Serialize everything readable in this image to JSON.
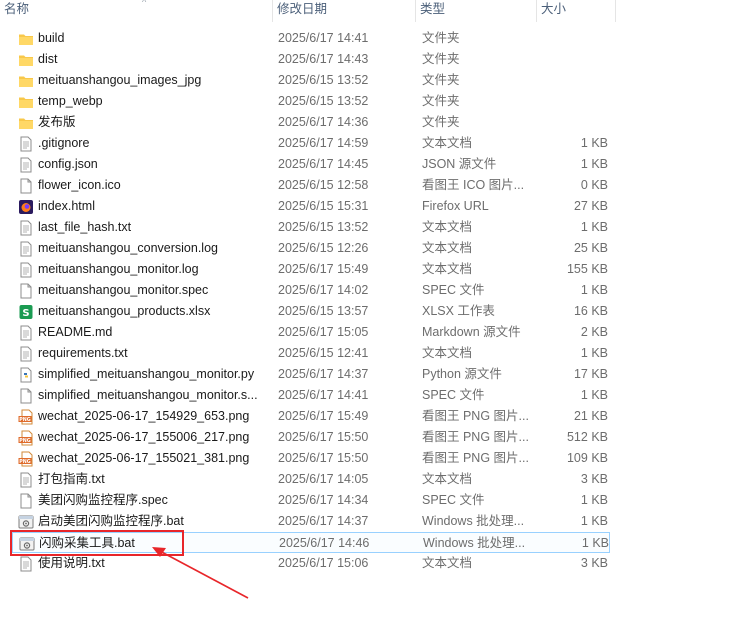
{
  "columns": {
    "name": "名称",
    "date": "修改日期",
    "type": "类型",
    "size": "大小"
  },
  "files": [
    {
      "name": "build",
      "date": "2025/6/17 14:41",
      "type": "文件夹",
      "size": "",
      "icon": "folder-icon"
    },
    {
      "name": "dist",
      "date": "2025/6/17 14:43",
      "type": "文件夹",
      "size": "",
      "icon": "folder-icon"
    },
    {
      "name": "meituanshangou_images_jpg",
      "date": "2025/6/15 13:52",
      "type": "文件夹",
      "size": "",
      "icon": "folder-icon"
    },
    {
      "name": "temp_webp",
      "date": "2025/6/15 13:52",
      "type": "文件夹",
      "size": "",
      "icon": "folder-icon"
    },
    {
      "name": "发布版",
      "date": "2025/6/17 14:36",
      "type": "文件夹",
      "size": "",
      "icon": "folder-icon"
    },
    {
      "name": ".gitignore",
      "date": "2025/6/17 14:59",
      "type": "文本文档",
      "size": "1 KB",
      "icon": "text-file-icon"
    },
    {
      "name": "config.json",
      "date": "2025/6/17 14:45",
      "type": "JSON 源文件",
      "size": "1 KB",
      "icon": "text-file-icon"
    },
    {
      "name": "flower_icon.ico",
      "date": "2025/6/15 12:58",
      "type": "看图王 ICO 图片...",
      "size": "0 KB",
      "icon": "blank-file-icon"
    },
    {
      "name": "index.html",
      "date": "2025/6/15 15:31",
      "type": "Firefox URL",
      "size": "27 KB",
      "icon": "firefox-icon"
    },
    {
      "name": "last_file_hash.txt",
      "date": "2025/6/15 13:52",
      "type": "文本文档",
      "size": "1 KB",
      "icon": "text-file-icon"
    },
    {
      "name": "meituanshangou_conversion.log",
      "date": "2025/6/15 12:26",
      "type": "文本文档",
      "size": "25 KB",
      "icon": "text-file-icon"
    },
    {
      "name": "meituanshangou_monitor.log",
      "date": "2025/6/17 15:49",
      "type": "文本文档",
      "size": "155 KB",
      "icon": "text-file-icon"
    },
    {
      "name": "meituanshangou_monitor.spec",
      "date": "2025/6/17 14:02",
      "type": "SPEC 文件",
      "size": "1 KB",
      "icon": "blank-file-icon"
    },
    {
      "name": "meituanshangou_products.xlsx",
      "date": "2025/6/15 13:57",
      "type": "XLSX 工作表",
      "size": "16 KB",
      "icon": "spreadsheet-icon"
    },
    {
      "name": "README.md",
      "date": "2025/6/17 15:05",
      "type": "Markdown 源文件",
      "size": "2 KB",
      "icon": "text-file-icon"
    },
    {
      "name": "requirements.txt",
      "date": "2025/6/15 12:41",
      "type": "文本文档",
      "size": "1 KB",
      "icon": "text-file-icon"
    },
    {
      "name": "simplified_meituanshangou_monitor.py",
      "date": "2025/6/17 14:37",
      "type": "Python 源文件",
      "size": "17 KB",
      "icon": "python-file-icon"
    },
    {
      "name": "simplified_meituanshangou_monitor.s...",
      "date": "2025/6/17 14:41",
      "type": "SPEC 文件",
      "size": "1 KB",
      "icon": "blank-file-icon"
    },
    {
      "name": "wechat_2025-06-17_154929_653.png",
      "date": "2025/6/17 15:49",
      "type": "看图王 PNG 图片...",
      "size": "21 KB",
      "icon": "png-image-icon"
    },
    {
      "name": "wechat_2025-06-17_155006_217.png",
      "date": "2025/6/17 15:50",
      "type": "看图王 PNG 图片...",
      "size": "512 KB",
      "icon": "png-image-icon"
    },
    {
      "name": "wechat_2025-06-17_155021_381.png",
      "date": "2025/6/17 15:50",
      "type": "看图王 PNG 图片...",
      "size": "109 KB",
      "icon": "png-image-icon"
    },
    {
      "name": "打包指南.txt",
      "date": "2025/6/17 14:05",
      "type": "文本文档",
      "size": "3 KB",
      "icon": "text-file-icon"
    },
    {
      "name": "美团闪购监控程序.spec",
      "date": "2025/6/17 14:34",
      "type": "SPEC 文件",
      "size": "1 KB",
      "icon": "blank-file-icon"
    },
    {
      "name": "启动美团闪购监控程序.bat",
      "date": "2025/6/17 14:37",
      "type": "Windows 批处理...",
      "size": "1 KB",
      "icon": "batch-file-icon"
    },
    {
      "name": "闪购采集工具.bat",
      "date": "2025/6/17 14:46",
      "type": "Windows 批处理...",
      "size": "1 KB",
      "icon": "batch-file-icon",
      "selected": true
    },
    {
      "name": "使用说明.txt",
      "date": "2025/6/17 15:06",
      "type": "文本文档",
      "size": "3 KB",
      "icon": "text-file-icon"
    }
  ],
  "annotation_color": "#e8262a"
}
